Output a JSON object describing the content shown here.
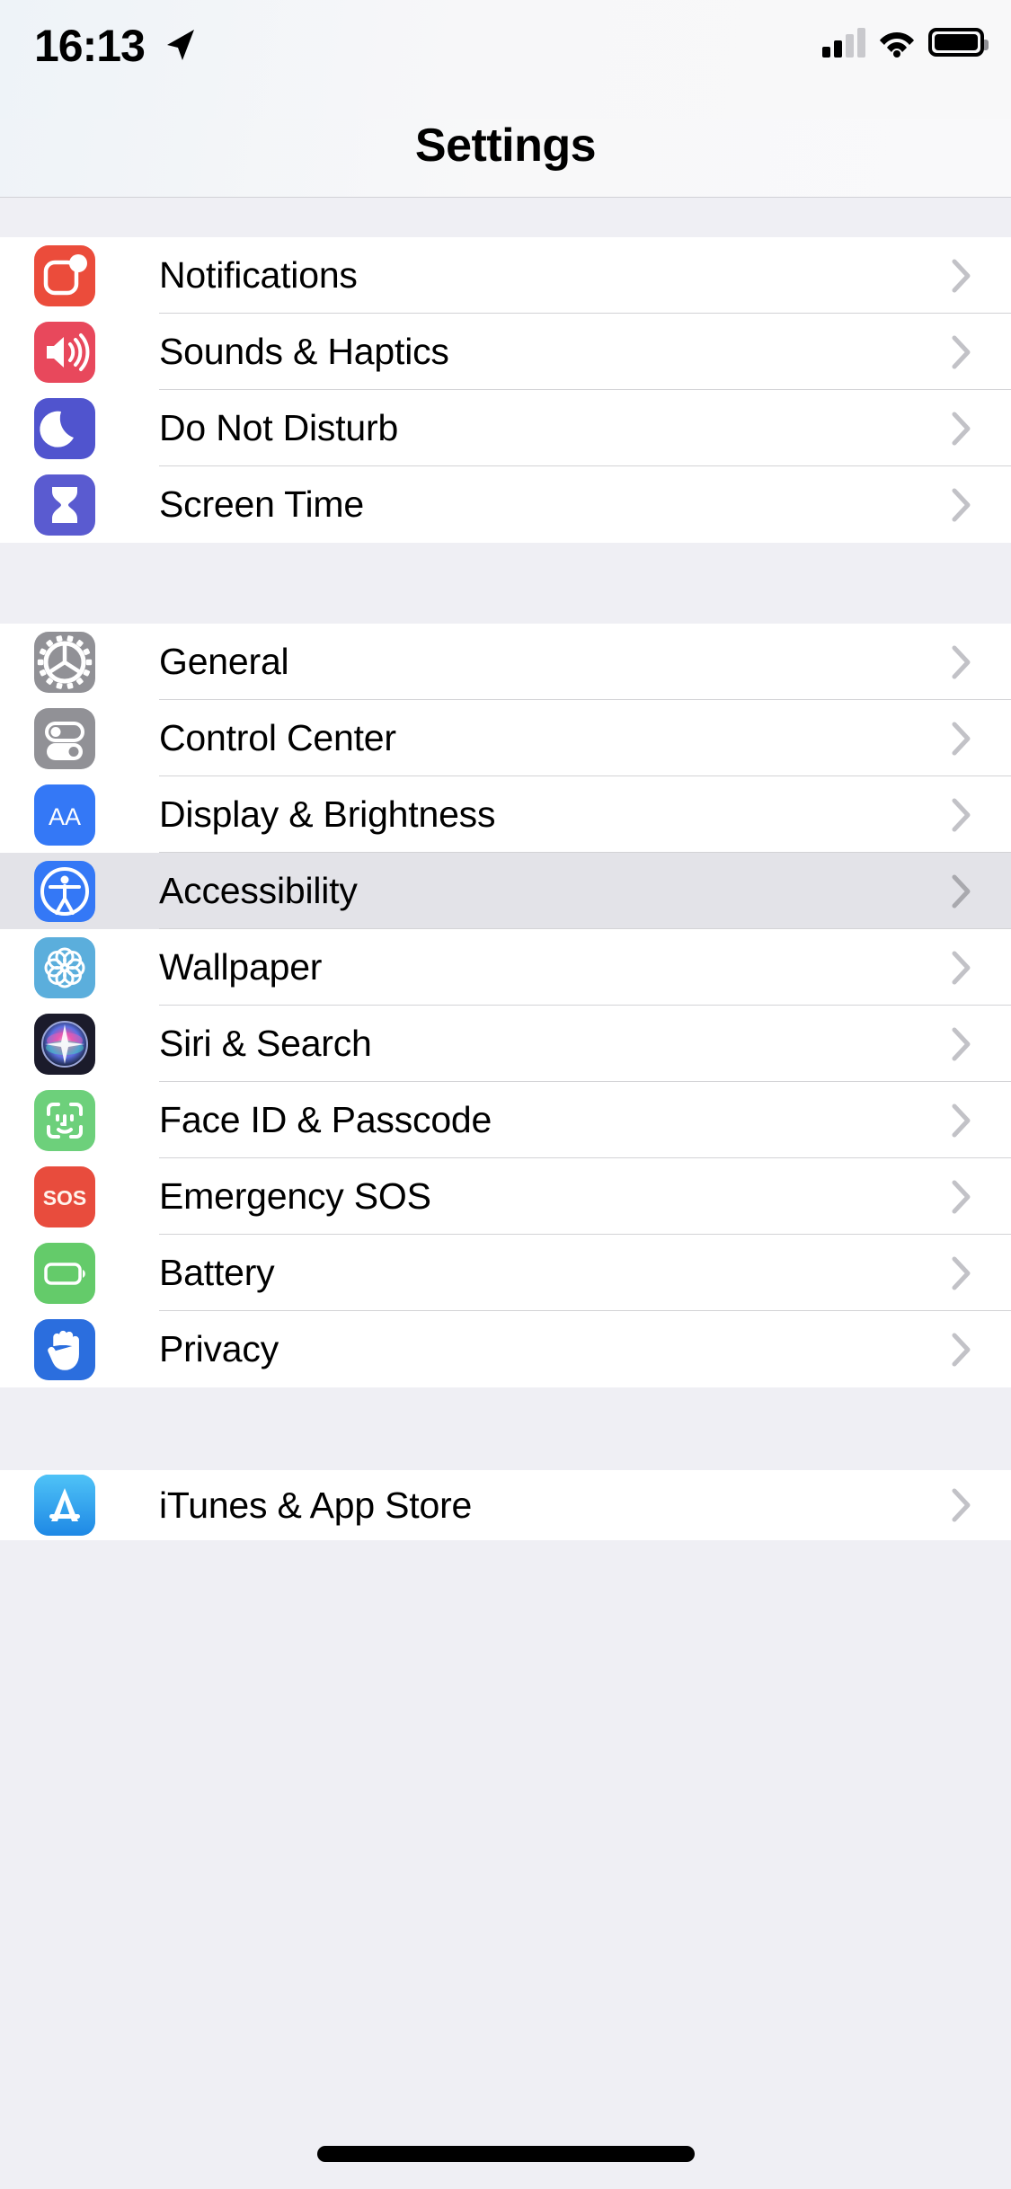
{
  "status_bar": {
    "time": "16:13",
    "location_icon": "location-arrow-icon",
    "cellular_icon": "cellular-signal-icon",
    "cellular_bars_filled": 2,
    "cellular_bars_total": 4,
    "wifi_icon": "wifi-icon",
    "battery_icon": "battery-full-icon"
  },
  "nav": {
    "title": "Settings"
  },
  "sections": [
    {
      "id": "notifications-group",
      "rows": [
        {
          "label": "Notifications",
          "icon": "notifications-icon",
          "color": "#EB4C3B",
          "selected": false
        },
        {
          "label": "Sounds & Haptics",
          "icon": "speaker-icon",
          "color": "#E8485C",
          "selected": false
        },
        {
          "label": "Do Not Disturb",
          "icon": "moon-icon",
          "color": "#5054CE",
          "selected": false
        },
        {
          "label": "Screen Time",
          "icon": "hourglass-icon",
          "color": "#5A5BD0",
          "selected": false
        }
      ]
    },
    {
      "id": "system-group",
      "rows": [
        {
          "label": "General",
          "icon": "gear-icon",
          "color": "#919196",
          "selected": false
        },
        {
          "label": "Control Center",
          "icon": "toggles-icon",
          "color": "#919196",
          "selected": false
        },
        {
          "label": "Display & Brightness",
          "icon": "text-size-icon",
          "color": "#3478F6",
          "selected": false
        },
        {
          "label": "Accessibility",
          "icon": "accessibility-icon",
          "color": "#3478F6",
          "selected": true
        },
        {
          "label": "Wallpaper",
          "icon": "flower-icon",
          "color": "#5BAEDC",
          "selected": false
        },
        {
          "label": "Siri & Search",
          "icon": "siri-orb-icon",
          "color": "#1B1B2B",
          "selected": false
        },
        {
          "label": "Face ID & Passcode",
          "icon": "face-id-icon",
          "color": "#6DD07B",
          "selected": false
        },
        {
          "label": "Emergency SOS",
          "icon": "sos-icon",
          "color": "#E84C3D",
          "selected": false
        },
        {
          "label": "Battery",
          "icon": "battery-icon",
          "color": "#64CB6A",
          "selected": false
        },
        {
          "label": "Privacy",
          "icon": "hand-icon",
          "color": "#2B6EDE",
          "selected": false
        }
      ]
    },
    {
      "id": "store-group",
      "rows": [
        {
          "label": "iTunes & App Store",
          "icon": "app-store-icon",
          "color": "#3CA7E8",
          "selected": false
        }
      ]
    }
  ],
  "sos_icon_text": "SOS",
  "display_icon_text": "AA",
  "home_indicator": "home-indicator"
}
